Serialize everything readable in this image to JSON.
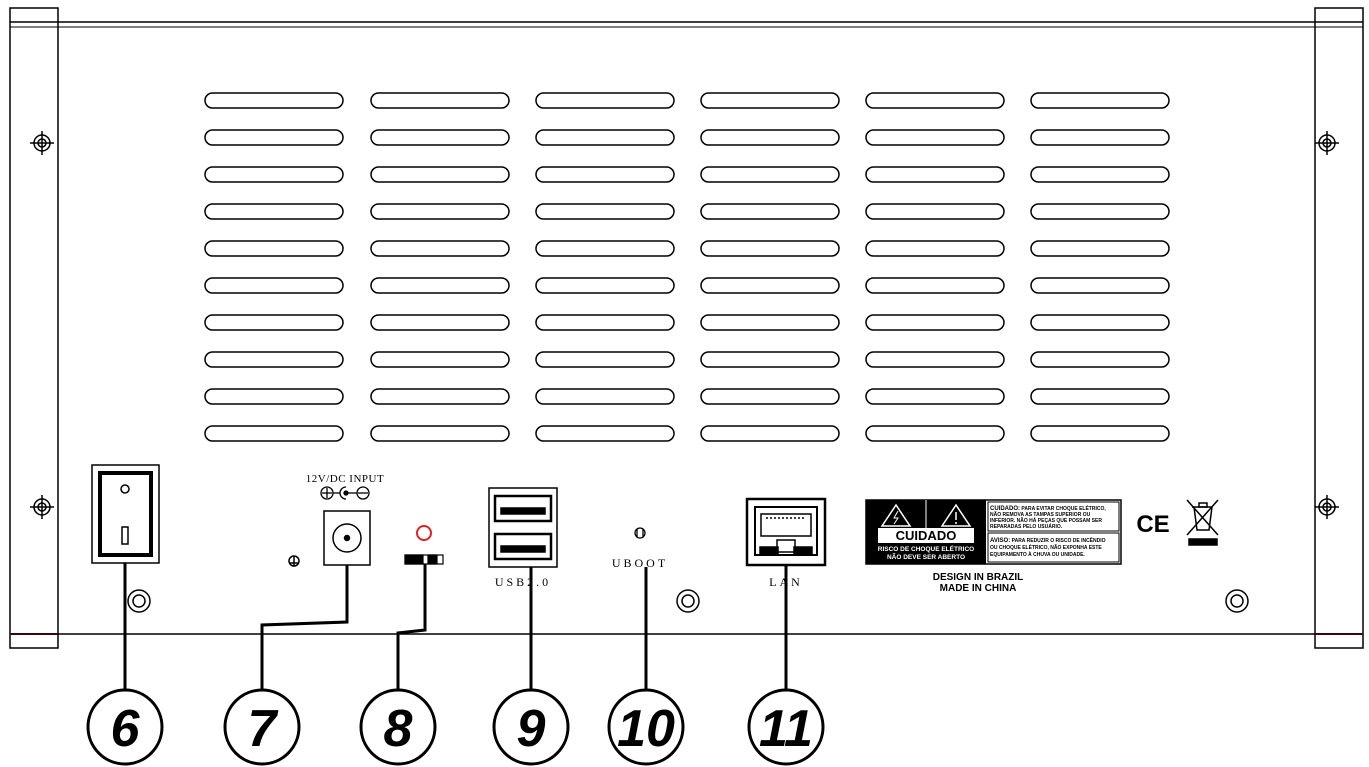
{
  "ports": {
    "power_input": "12V/DC  INPUT",
    "usb": "USB2.0",
    "uboot": "UBOOT",
    "lan": "LAN"
  },
  "warning_label": {
    "title": "CUIDADO",
    "line1": "RISCO DE CHOQUE ELÉTRICO",
    "line2": "NÃO DEVE SER ABERTO",
    "cuidado_heading": "CUIDADO:",
    "cuidado_text_1": "PARA EVITAR CHOQUE ELÉTRICO,",
    "cuidado_text_2": "NÃO REMOVA AS TAMPAS SUPERIOR OU",
    "cuidado_text_3": "INFERIOR. NÃO HÁ PEÇAS QUE POSSAM SER",
    "cuidado_text_4": "REPARADAS PELO USUÁRIO.",
    "aviso_heading": "AVISO:",
    "aviso_text_1": "PARA REDUZIR O RISCO DE INCÊNDIO",
    "aviso_text_2": "OU CHOQUE ELÉTRICO, NÃO EXPONHA ESTE",
    "aviso_text_3": "EQUIPAMENTO À CHUVA OU UNIDADE."
  },
  "origin": {
    "design": "DESIGN IN BRAZIL",
    "made": "MADE  IN  CHINA"
  },
  "certification": "CE",
  "callouts": [
    "6",
    "7",
    "8",
    "9",
    "10",
    "11"
  ]
}
